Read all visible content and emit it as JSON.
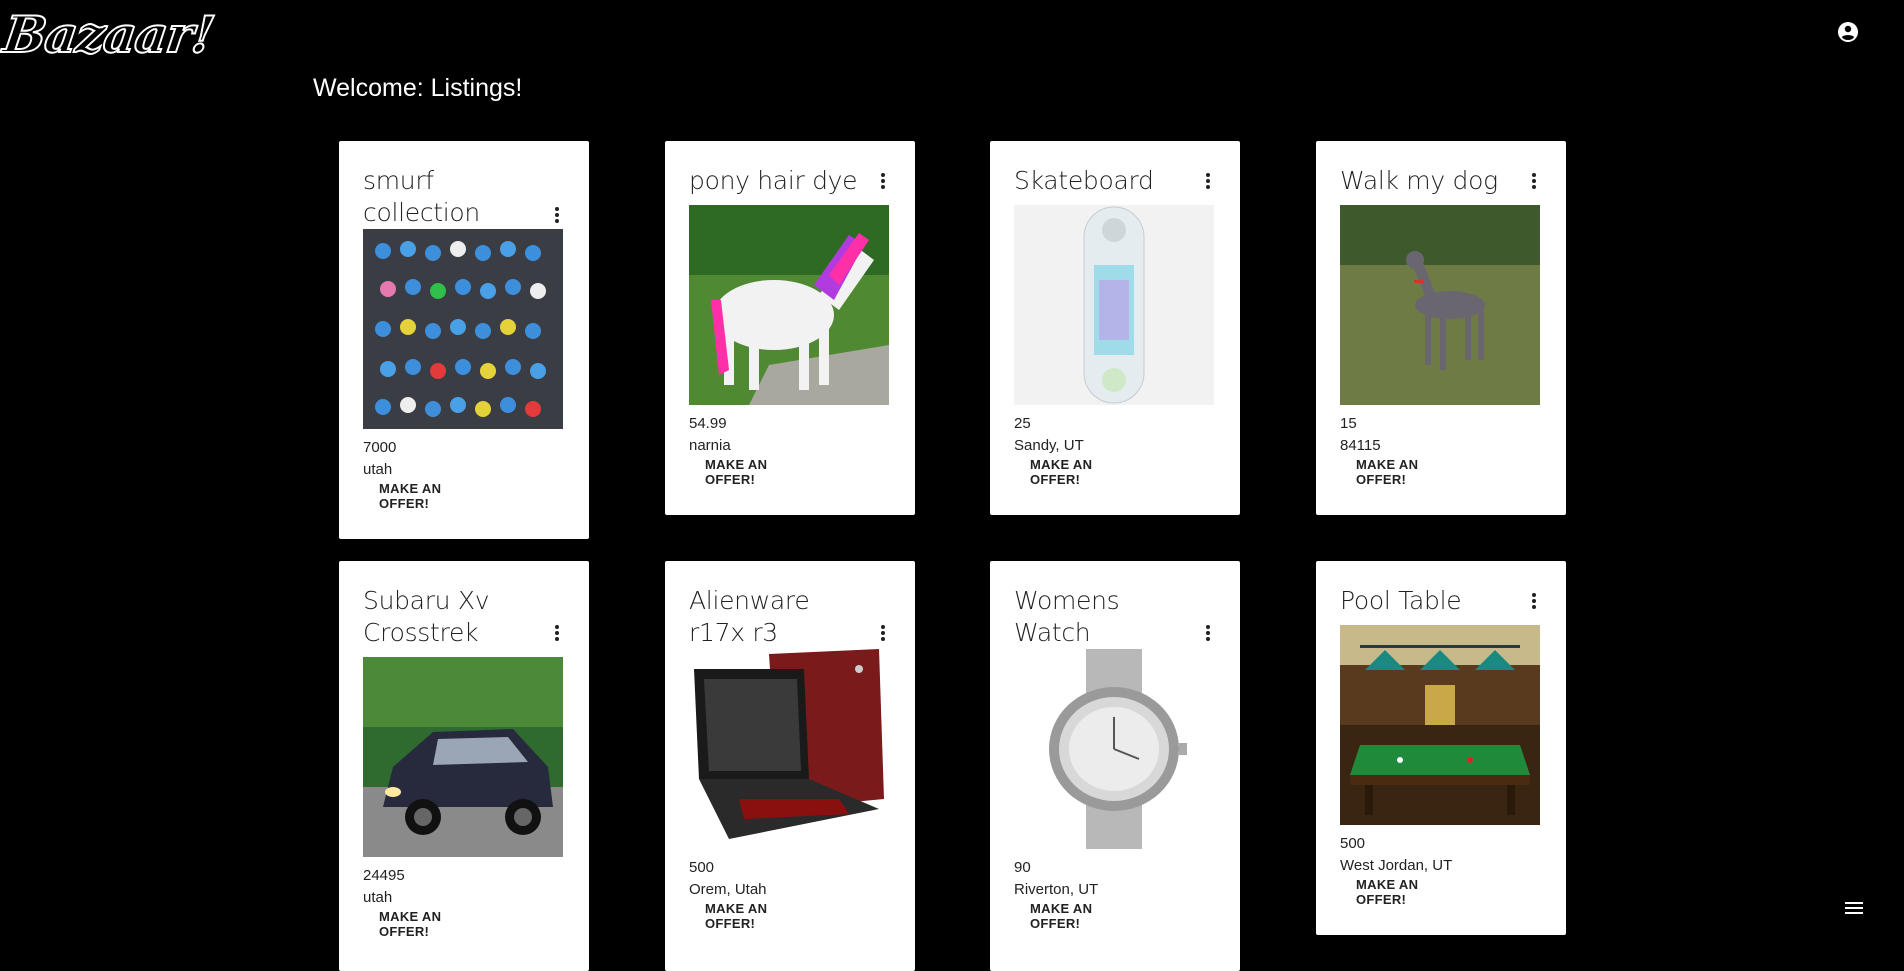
{
  "app": {
    "logo_text": "Bazaar!",
    "account_icon": "account-circle-icon",
    "menu_icon": "hamburger-menu-icon"
  },
  "page": {
    "welcome": "Welcome: Listings!"
  },
  "listings": [
    {
      "title": "smurf collection",
      "price": "7000",
      "location": "utah",
      "offer_label": "MAKE AN OFFER!",
      "image": "smurf figurines collection"
    },
    {
      "title": "pony hair dye",
      "price": "54.99",
      "location": "narnia",
      "offer_label": "MAKE AN OFFER!",
      "image": "white pony with pink and purple mane"
    },
    {
      "title": "Skateboard",
      "price": "25",
      "location": "Sandy, UT",
      "offer_label": "MAKE AN OFFER!",
      "image": "holographic skateboard deck"
    },
    {
      "title": "Walk my dog",
      "price": "15",
      "location": "84115",
      "offer_label": "MAKE AN OFFER!",
      "image": "grey greyhound on grass"
    },
    {
      "title": "Subaru Xv Crosstrek",
      "price": "24495",
      "location": "utah",
      "offer_label": "MAKE AN OFFER!",
      "image": "dark blue subaru suv"
    },
    {
      "title": "Alienware r17x r3",
      "price": "500",
      "location": "Orem, Utah",
      "offer_label": "MAKE AN OFFER!",
      "image": "red alienware laptop"
    },
    {
      "title": "Womens Watch",
      "price": "90",
      "location": "Riverton, UT",
      "offer_label": "MAKE AN OFFER!",
      "image": "silver wristwatch"
    },
    {
      "title": "Pool Table",
      "price": "500",
      "location": "West Jordan, UT",
      "offer_label": "MAKE AN OFFER!",
      "image": "green pool table with lamps"
    }
  ]
}
